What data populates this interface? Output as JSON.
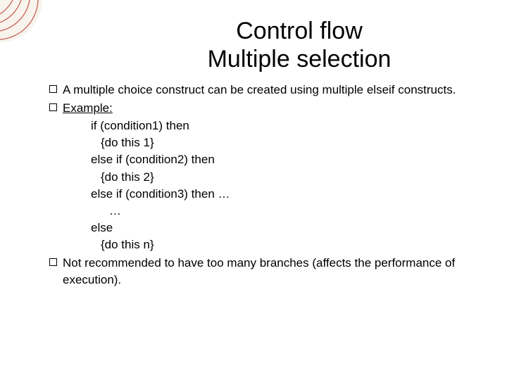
{
  "title": {
    "line1": "Control flow",
    "line2": "Multiple selection"
  },
  "bullets": {
    "b1_a": "A multiple choice construct can be created using multiple ",
    "b1_b": "elseif",
    "b1_c": " constructs.",
    "b2": "Example:",
    "b3": "Not recommended to have too many branches (affects the performance of execution)."
  },
  "code": {
    "l1": "if (condition1) then",
    "l2": "{do this 1}",
    "l3": "else if (condition2) then",
    "l4": "{do this 2}",
    "l5": "else if (condition3) then …",
    "l6": "…",
    "l7": "else",
    "l8": "{do this n}"
  }
}
